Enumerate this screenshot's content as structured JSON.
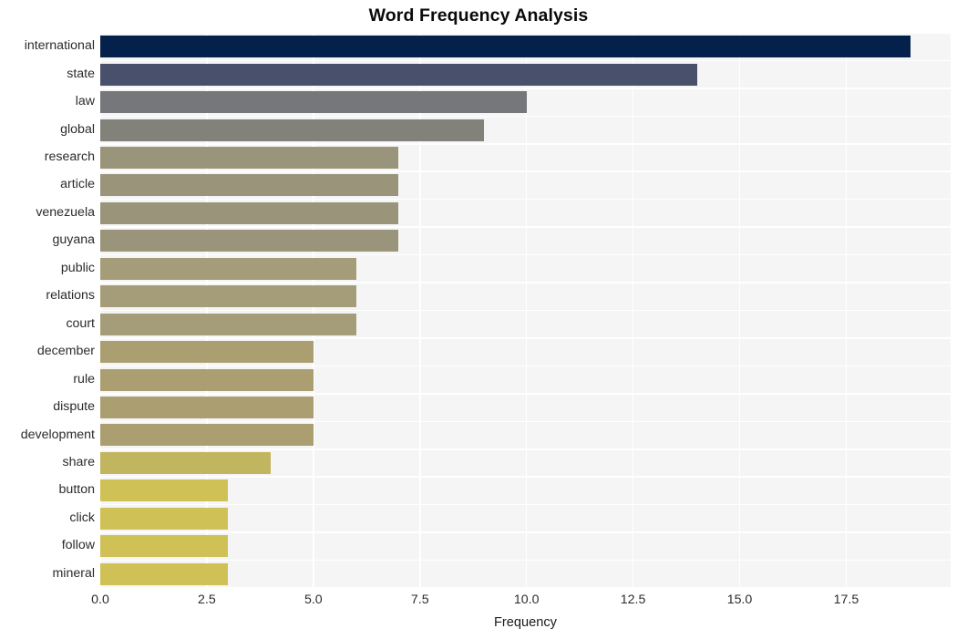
{
  "chart_data": {
    "type": "bar",
    "orientation": "horizontal",
    "title": "Word Frequency Analysis",
    "xlabel": "Frequency",
    "ylabel": "",
    "categories": [
      "international",
      "state",
      "law",
      "global",
      "research",
      "article",
      "venezuela",
      "guyana",
      "public",
      "relations",
      "court",
      "december",
      "rule",
      "dispute",
      "development",
      "share",
      "button",
      "click",
      "follow",
      "mineral"
    ],
    "values": [
      19,
      14,
      10,
      9,
      7,
      7,
      7,
      7,
      6,
      6,
      6,
      5,
      5,
      5,
      5,
      4,
      3,
      3,
      3,
      3
    ],
    "bar_colors": [
      "#03214a",
      "#48506c",
      "#75777a",
      "#82817a",
      "#9a957a",
      "#9a957a",
      "#9a957a",
      "#9a957a",
      "#a59d79",
      "#a59d79",
      "#a59d79",
      "#ab9f72",
      "#ab9f72",
      "#ab9f72",
      "#ab9f72",
      "#c2b55f",
      "#d0c156",
      "#d0c156",
      "#d0c156",
      "#d0c156"
    ],
    "xlim": [
      0,
      19.95
    ],
    "xticks": [
      "0.0",
      "2.5",
      "5.0",
      "7.5",
      "10.0",
      "12.5",
      "15.0",
      "17.5"
    ],
    "xtick_values": [
      0,
      2.5,
      5,
      7.5,
      10,
      12.5,
      15,
      17.5
    ],
    "grid": true,
    "grid_color": "#ffffff",
    "plot_background": "#f5f5f6",
    "figure_background": "#ffffff",
    "legend": null
  }
}
